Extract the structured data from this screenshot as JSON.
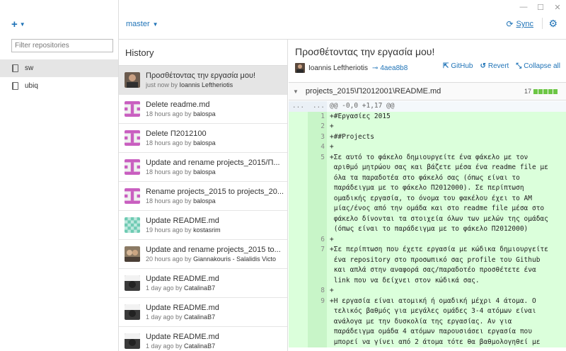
{
  "window": {
    "minimize": "—",
    "maximize": "☐",
    "close": "✕"
  },
  "sidebar": {
    "add_icon": "+",
    "filter_placeholder": "Filter repositories",
    "repos": [
      {
        "name": "sw",
        "active": true
      },
      {
        "name": "ubiq",
        "active": false
      }
    ]
  },
  "header": {
    "branch": "master",
    "sync_label": "Sync"
  },
  "history": {
    "title": "History",
    "commits": [
      {
        "title": "Προσθέτοντας την εργασία μου!",
        "time": "just now by ",
        "author": "Ioannis Leftheriotis",
        "avatar": "photo-man",
        "active": true
      },
      {
        "title": "Delete readme.md",
        "time": "18 hours ago by ",
        "author": "balospa",
        "avatar": "identicon-pink"
      },
      {
        "title": "Delete Π2012100",
        "time": "18 hours ago by ",
        "author": "balospa",
        "avatar": "identicon-pink"
      },
      {
        "title": "Update and rename projects_2015/Π...",
        "time": "18 hours ago by ",
        "author": "balospa",
        "avatar": "identicon-pink"
      },
      {
        "title": "Rename projects_2015 to projects_20...",
        "time": "18 hours ago by ",
        "author": "balospa",
        "avatar": "identicon-pink"
      },
      {
        "title": "Update README.md",
        "time": "19 hours ago by ",
        "author": "kostasrim",
        "avatar": "identicon-teal"
      },
      {
        "title": "Update and rename projects_2015 to...",
        "time": "20 hours ago by ",
        "author": "Giannakouris - Salalidis Victo",
        "avatar": "photo-group"
      },
      {
        "title": "Update README.md",
        "time": "1 day ago by ",
        "author": "CatalinaB7",
        "avatar": "photo-dark"
      },
      {
        "title": "Update README.md",
        "time": "1 day ago by ",
        "author": "CatalinaB7",
        "avatar": "photo-dark"
      },
      {
        "title": "Update README.md",
        "time": "1 day ago by ",
        "author": "CatalinaB7",
        "avatar": "photo-dark"
      }
    ]
  },
  "detail": {
    "title": "Προσθέτοντας την εργασία μου!",
    "author": "Ioannis Leftheriotis",
    "sha": "4aea8b8",
    "actions": {
      "github": "GitHub",
      "revert": "Revert",
      "collapse": "Collapse all"
    },
    "file": {
      "path": "projects_2015\\Π2012001\\README.md",
      "additions": "17"
    },
    "diff": [
      {
        "type": "hunk",
        "old": "...",
        "new": "...",
        "text": "@@ -0,0 +1,17 @@"
      },
      {
        "type": "add",
        "old": "",
        "new": "1",
        "text": "+#Εργασίες 2015"
      },
      {
        "type": "add",
        "old": "",
        "new": "2",
        "text": "+"
      },
      {
        "type": "add",
        "old": "",
        "new": "3",
        "text": "+##Projects"
      },
      {
        "type": "add",
        "old": "",
        "new": "4",
        "text": "+"
      },
      {
        "type": "add",
        "old": "",
        "new": "5",
        "text": "+Σε αυτό το φάκελο δημιουργείτε ένα φάκελο με τον"
      },
      {
        "type": "add",
        "old": "",
        "new": "",
        "text": " αριθμό μητρώου σας και βάζετε μέσα ένα readme file με"
      },
      {
        "type": "add",
        "old": "",
        "new": "",
        "text": " όλα τα παραδοτέα στο φάκελό σας (όπως είναι το"
      },
      {
        "type": "add",
        "old": "",
        "new": "",
        "text": " παράδειγμα με το φάκελο Π2012000). Σε περίπτωση"
      },
      {
        "type": "add",
        "old": "",
        "new": "",
        "text": " ομαδικής εργασία, το όνομα του φακέλου έχει το ΑΜ"
      },
      {
        "type": "add",
        "old": "",
        "new": "",
        "text": " μίας/ένος από την ομάδα και στο readme file μέσα στο"
      },
      {
        "type": "add",
        "old": "",
        "new": "",
        "text": " φάκελο δίνονται τα στοιχεία όλων των μελών της ομάδας"
      },
      {
        "type": "add",
        "old": "",
        "new": "",
        "text": " (όπως είναι το παράδειγμα με το φάκελο Π2012000)"
      },
      {
        "type": "add",
        "old": "",
        "new": "6",
        "text": "+"
      },
      {
        "type": "add",
        "old": "",
        "new": "7",
        "text": "+Σε περίπτωση που έχετε εργασία με κώδικα δημιουργείτε"
      },
      {
        "type": "add",
        "old": "",
        "new": "",
        "text": " ένα repository στο προσωπικό σας profile του Github"
      },
      {
        "type": "add",
        "old": "",
        "new": "",
        "text": " και απλά στην αναφορά σας/παραδοτέο προσθέτετε ένα"
      },
      {
        "type": "add",
        "old": "",
        "new": "",
        "text": " link που να δείχνει στον κώδικά σας."
      },
      {
        "type": "add",
        "old": "",
        "new": "8",
        "text": "+"
      },
      {
        "type": "add",
        "old": "",
        "new": "9",
        "text": "+Η εργασία είναι ατομική ή ομαδική μέχρι 4 άτομα. Ο"
      },
      {
        "type": "add",
        "old": "",
        "new": "",
        "text": " τελικός βαθμός για μεγάλες ομάδες 3-4 ατόμων είναι"
      },
      {
        "type": "add",
        "old": "",
        "new": "",
        "text": " ανάλογα με την δυσκολία της εργασίας. Αν για"
      },
      {
        "type": "add",
        "old": "",
        "new": "",
        "text": " παράδειγμα ομάδα 4 ατόμων παρουσιάσει εργασία που"
      },
      {
        "type": "add",
        "old": "",
        "new": "",
        "text": " μπορεί να γίνει από 2 άτομα τότε θα βαθμολογηθεί με"
      }
    ]
  }
}
